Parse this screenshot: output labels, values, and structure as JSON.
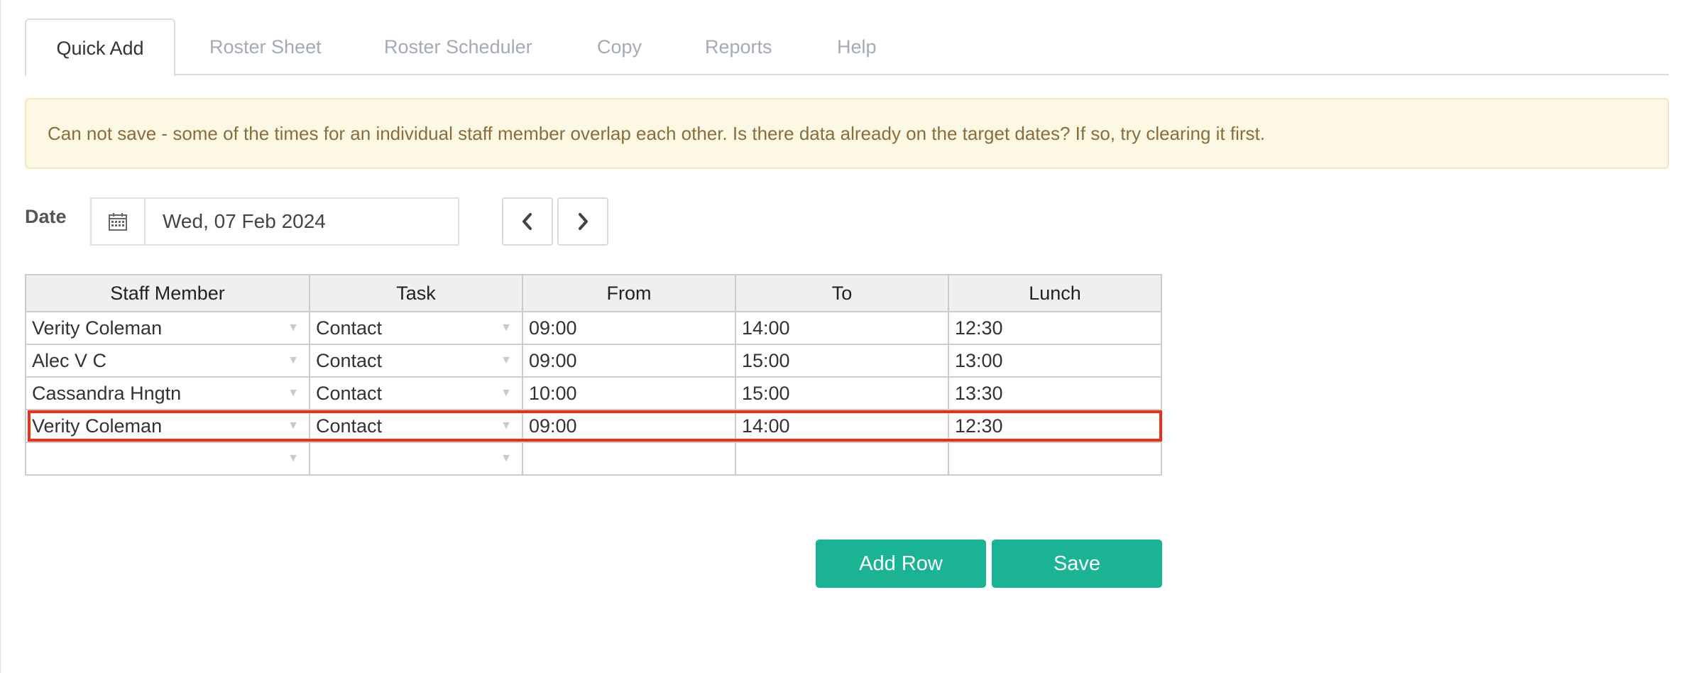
{
  "tabs": [
    {
      "label": "Quick Add",
      "active": true
    },
    {
      "label": "Roster Sheet",
      "active": false
    },
    {
      "label": "Roster Scheduler",
      "active": false
    },
    {
      "label": "Copy",
      "active": false
    },
    {
      "label": "Reports",
      "active": false
    },
    {
      "label": "Help",
      "active": false
    }
  ],
  "alert": {
    "text": "Can not save - some of the times for an individual staff member overlap each other. Is there data already on the target dates? If so, try clearing it first."
  },
  "date": {
    "label": "Date",
    "value": "Wed, 07 Feb 2024",
    "icon": "calendar-icon",
    "prev_icon": "chevron-left-icon",
    "next_icon": "chevron-right-icon"
  },
  "grid": {
    "headers": [
      "Staff Member",
      "Task",
      "From",
      "To",
      "Lunch"
    ],
    "rows": [
      {
        "staff": "Verity Coleman",
        "task": "Contact",
        "from": "09:00",
        "to": "14:00",
        "lunch": "12:30"
      },
      {
        "staff": "Alec V C",
        "task": "Contact",
        "from": "09:00",
        "to": "15:00",
        "lunch": "13:00"
      },
      {
        "staff": "Cassandra Hngtn",
        "task": "Contact",
        "from": "10:00",
        "to": "15:00",
        "lunch": "13:30"
      },
      {
        "staff": "Verity Coleman",
        "task": "Contact",
        "from": "09:00",
        "to": "14:00",
        "lunch": "12:30"
      },
      {
        "staff": "",
        "task": "",
        "from": "",
        "to": "",
        "lunch": ""
      }
    ],
    "dropdown_glyph": "▼"
  },
  "buttons": {
    "add_row": "Add Row",
    "save": "Save"
  },
  "colors": {
    "accent": "#1ab394",
    "alert_bg": "#fcf8e3",
    "alert_text": "#8a6d3b",
    "highlight": "#e8321c"
  }
}
